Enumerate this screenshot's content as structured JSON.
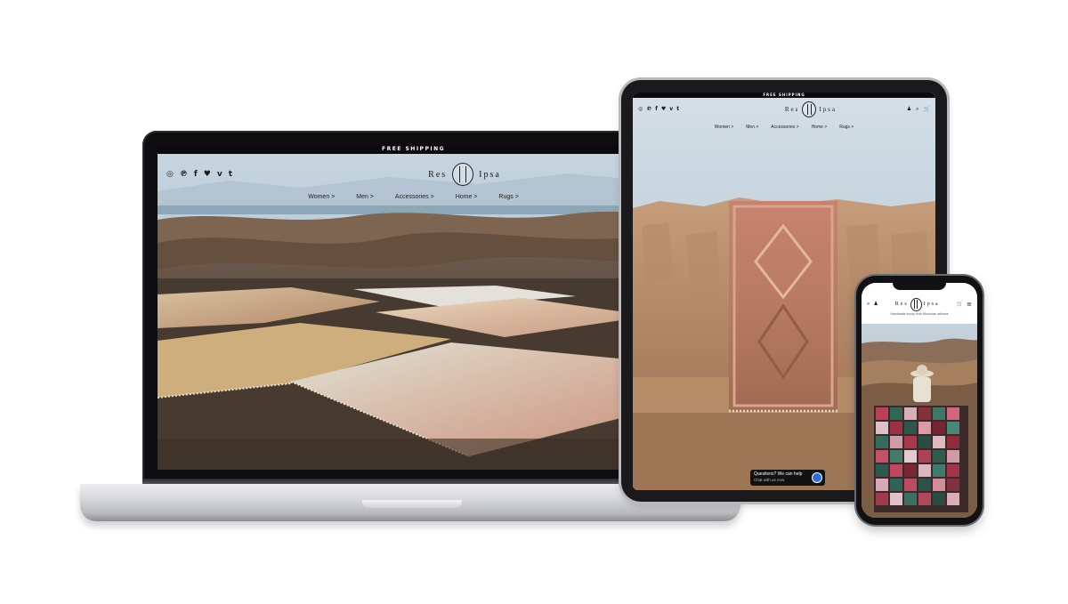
{
  "brand": {
    "name_left": "Res",
    "name_right": "Ipsa",
    "promo_banner": "FREE SHIPPING"
  },
  "navigation": {
    "items": [
      {
        "label": "Women >"
      },
      {
        "label": "Men >"
      },
      {
        "label": "Accessories >"
      },
      {
        "label": "Home >"
      },
      {
        "label": "Rugs >"
      }
    ]
  },
  "social_icons": [
    "instagram-icon",
    "pinterest-icon",
    "facebook-icon",
    "twitter-icon",
    "vimeo-icon",
    "tumblr-icon"
  ],
  "social_glyphs": [
    "◎",
    "℗",
    "f",
    "♥",
    "v",
    "t"
  ],
  "header_tools": [
    "account-icon",
    "search-icon",
    "cart-icon"
  ],
  "header_tool_glyphs": [
    "♟",
    "⌕",
    "🛒"
  ],
  "tablet": {
    "chat": {
      "line1": "Questions? We can help",
      "line2": "Chat with us now"
    }
  },
  "phone": {
    "tagline": "Handmade luxury from Moroccan artisans"
  },
  "colors": {
    "sky": "#b9cad6",
    "desert": "#7a5b45",
    "badge": "#d6314a",
    "chat_dot": "#2b6fd6"
  }
}
